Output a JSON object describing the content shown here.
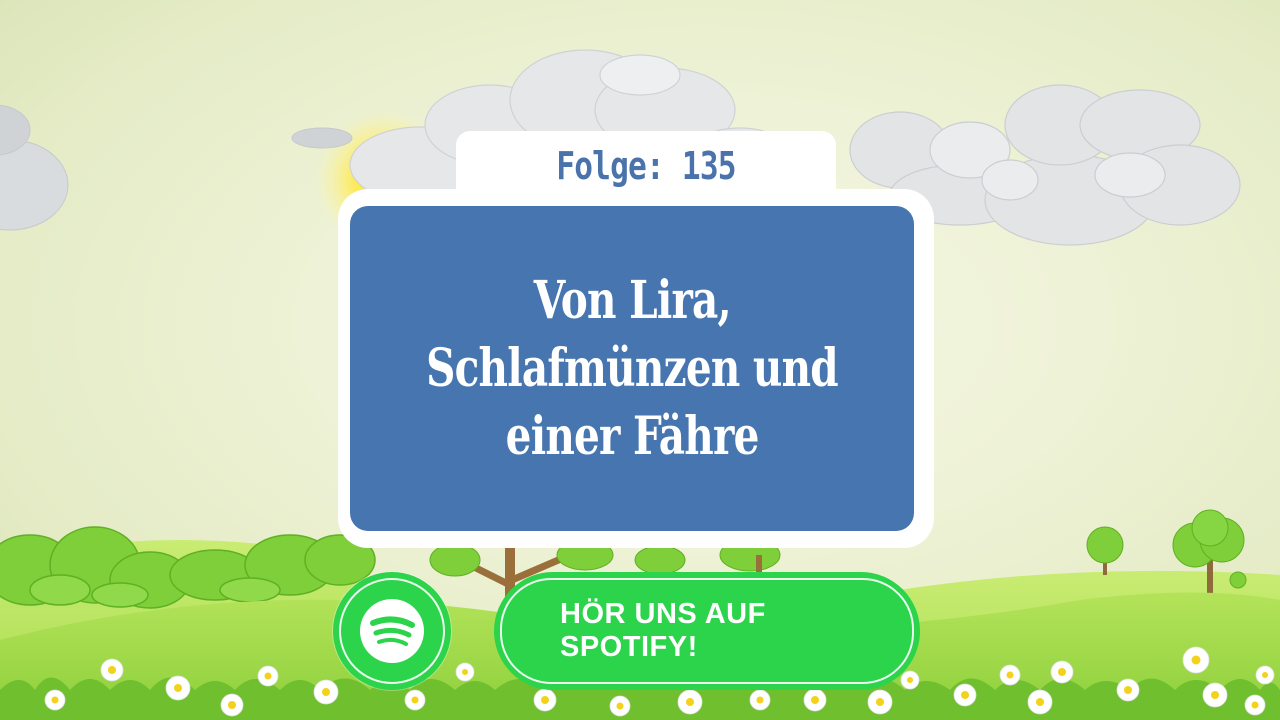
{
  "episode": {
    "label": "Folge: 135"
  },
  "title": {
    "lines": [
      "Von Lira,",
      "Schlafmünzen und",
      "einer Fähre"
    ]
  },
  "cta": {
    "label": "HÖR UNS AUF\nSPOTIFY!",
    "icon": "spotify-icon"
  },
  "colors": {
    "panel": "#4775af",
    "episode_text": "#4a72ab",
    "spotify_green": "#2bd44a",
    "sky": "#eef2d6",
    "grass": "#8fd13f"
  }
}
